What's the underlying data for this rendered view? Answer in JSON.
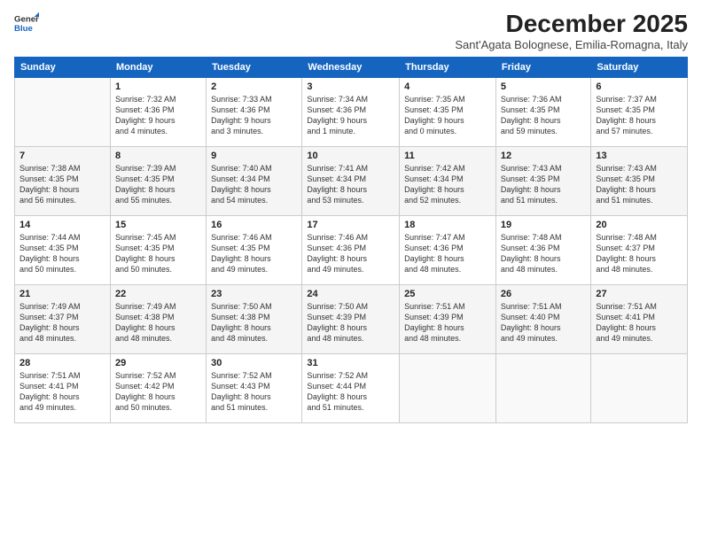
{
  "header": {
    "logo_line1": "General",
    "logo_line2": "Blue",
    "title": "December 2025",
    "subtitle": "Sant'Agata Bolognese, Emilia-Romagna, Italy"
  },
  "columns": [
    "Sunday",
    "Monday",
    "Tuesday",
    "Wednesday",
    "Thursday",
    "Friday",
    "Saturday"
  ],
  "weeks": [
    [
      {
        "day": "",
        "info": ""
      },
      {
        "day": "1",
        "info": "Sunrise: 7:32 AM\nSunset: 4:36 PM\nDaylight: 9 hours\nand 4 minutes."
      },
      {
        "day": "2",
        "info": "Sunrise: 7:33 AM\nSunset: 4:36 PM\nDaylight: 9 hours\nand 3 minutes."
      },
      {
        "day": "3",
        "info": "Sunrise: 7:34 AM\nSunset: 4:36 PM\nDaylight: 9 hours\nand 1 minute."
      },
      {
        "day": "4",
        "info": "Sunrise: 7:35 AM\nSunset: 4:35 PM\nDaylight: 9 hours\nand 0 minutes."
      },
      {
        "day": "5",
        "info": "Sunrise: 7:36 AM\nSunset: 4:35 PM\nDaylight: 8 hours\nand 59 minutes."
      },
      {
        "day": "6",
        "info": "Sunrise: 7:37 AM\nSunset: 4:35 PM\nDaylight: 8 hours\nand 57 minutes."
      }
    ],
    [
      {
        "day": "7",
        "info": "Sunrise: 7:38 AM\nSunset: 4:35 PM\nDaylight: 8 hours\nand 56 minutes."
      },
      {
        "day": "8",
        "info": "Sunrise: 7:39 AM\nSunset: 4:35 PM\nDaylight: 8 hours\nand 55 minutes."
      },
      {
        "day": "9",
        "info": "Sunrise: 7:40 AM\nSunset: 4:34 PM\nDaylight: 8 hours\nand 54 minutes."
      },
      {
        "day": "10",
        "info": "Sunrise: 7:41 AM\nSunset: 4:34 PM\nDaylight: 8 hours\nand 53 minutes."
      },
      {
        "day": "11",
        "info": "Sunrise: 7:42 AM\nSunset: 4:34 PM\nDaylight: 8 hours\nand 52 minutes."
      },
      {
        "day": "12",
        "info": "Sunrise: 7:43 AM\nSunset: 4:35 PM\nDaylight: 8 hours\nand 51 minutes."
      },
      {
        "day": "13",
        "info": "Sunrise: 7:43 AM\nSunset: 4:35 PM\nDaylight: 8 hours\nand 51 minutes."
      }
    ],
    [
      {
        "day": "14",
        "info": "Sunrise: 7:44 AM\nSunset: 4:35 PM\nDaylight: 8 hours\nand 50 minutes."
      },
      {
        "day": "15",
        "info": "Sunrise: 7:45 AM\nSunset: 4:35 PM\nDaylight: 8 hours\nand 50 minutes."
      },
      {
        "day": "16",
        "info": "Sunrise: 7:46 AM\nSunset: 4:35 PM\nDaylight: 8 hours\nand 49 minutes."
      },
      {
        "day": "17",
        "info": "Sunrise: 7:46 AM\nSunset: 4:36 PM\nDaylight: 8 hours\nand 49 minutes."
      },
      {
        "day": "18",
        "info": "Sunrise: 7:47 AM\nSunset: 4:36 PM\nDaylight: 8 hours\nand 48 minutes."
      },
      {
        "day": "19",
        "info": "Sunrise: 7:48 AM\nSunset: 4:36 PM\nDaylight: 8 hours\nand 48 minutes."
      },
      {
        "day": "20",
        "info": "Sunrise: 7:48 AM\nSunset: 4:37 PM\nDaylight: 8 hours\nand 48 minutes."
      }
    ],
    [
      {
        "day": "21",
        "info": "Sunrise: 7:49 AM\nSunset: 4:37 PM\nDaylight: 8 hours\nand 48 minutes."
      },
      {
        "day": "22",
        "info": "Sunrise: 7:49 AM\nSunset: 4:38 PM\nDaylight: 8 hours\nand 48 minutes."
      },
      {
        "day": "23",
        "info": "Sunrise: 7:50 AM\nSunset: 4:38 PM\nDaylight: 8 hours\nand 48 minutes."
      },
      {
        "day": "24",
        "info": "Sunrise: 7:50 AM\nSunset: 4:39 PM\nDaylight: 8 hours\nand 48 minutes."
      },
      {
        "day": "25",
        "info": "Sunrise: 7:51 AM\nSunset: 4:39 PM\nDaylight: 8 hours\nand 48 minutes."
      },
      {
        "day": "26",
        "info": "Sunrise: 7:51 AM\nSunset: 4:40 PM\nDaylight: 8 hours\nand 49 minutes."
      },
      {
        "day": "27",
        "info": "Sunrise: 7:51 AM\nSunset: 4:41 PM\nDaylight: 8 hours\nand 49 minutes."
      }
    ],
    [
      {
        "day": "28",
        "info": "Sunrise: 7:51 AM\nSunset: 4:41 PM\nDaylight: 8 hours\nand 49 minutes."
      },
      {
        "day": "29",
        "info": "Sunrise: 7:52 AM\nSunset: 4:42 PM\nDaylight: 8 hours\nand 50 minutes."
      },
      {
        "day": "30",
        "info": "Sunrise: 7:52 AM\nSunset: 4:43 PM\nDaylight: 8 hours\nand 51 minutes."
      },
      {
        "day": "31",
        "info": "Sunrise: 7:52 AM\nSunset: 4:44 PM\nDaylight: 8 hours\nand 51 minutes."
      },
      {
        "day": "",
        "info": ""
      },
      {
        "day": "",
        "info": ""
      },
      {
        "day": "",
        "info": ""
      }
    ]
  ]
}
